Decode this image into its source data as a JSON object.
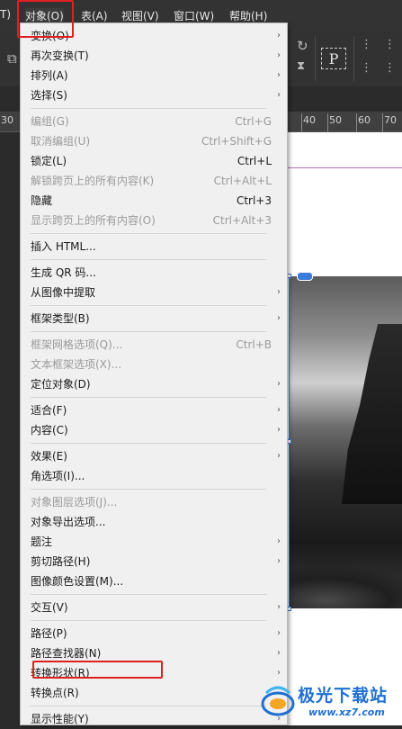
{
  "menubar": {
    "items": [
      {
        "label": "T)"
      },
      {
        "label": "对象(O)"
      },
      {
        "label": "表(A)"
      },
      {
        "label": "视图(V)"
      },
      {
        "label": "窗口(W)"
      },
      {
        "label": "帮助(H)"
      }
    ]
  },
  "toolbar": {
    "frame_icon_label": "P"
  },
  "ruler": {
    "left_label": "30",
    "labels": [
      "40",
      "50",
      "60",
      "70"
    ]
  },
  "object_menu": {
    "items": [
      {
        "label": "变换(O)",
        "shortcut": "",
        "submenu": true,
        "enabled": true
      },
      {
        "label": "再次变换(T)",
        "shortcut": "",
        "submenu": true,
        "enabled": true
      },
      {
        "label": "排列(A)",
        "shortcut": "",
        "submenu": true,
        "enabled": true
      },
      {
        "label": "选择(S)",
        "shortcut": "",
        "submenu": true,
        "enabled": true
      },
      {
        "label": "编组(G)",
        "shortcut": "Ctrl+G",
        "submenu": false,
        "enabled": false
      },
      {
        "label": "取消编组(U)",
        "shortcut": "Ctrl+Shift+G",
        "submenu": false,
        "enabled": false
      },
      {
        "label": "锁定(L)",
        "shortcut": "Ctrl+L",
        "submenu": false,
        "enabled": true
      },
      {
        "label": "解锁跨页上的所有内容(K)",
        "shortcut": "Ctrl+Alt+L",
        "submenu": false,
        "enabled": false
      },
      {
        "label": "隐藏",
        "shortcut": "Ctrl+3",
        "submenu": false,
        "enabled": true
      },
      {
        "label": "显示跨页上的所有内容(O)",
        "shortcut": "Ctrl+Alt+3",
        "submenu": false,
        "enabled": false
      },
      {
        "label": "插入 HTML...",
        "shortcut": "",
        "submenu": false,
        "enabled": true
      },
      {
        "label": "生成 QR 码...",
        "shortcut": "",
        "submenu": false,
        "enabled": true
      },
      {
        "label": "从图像中提取",
        "shortcut": "",
        "submenu": true,
        "enabled": true
      },
      {
        "label": "框架类型(B)",
        "shortcut": "",
        "submenu": true,
        "enabled": true
      },
      {
        "label": "框架网格选项(Q)...",
        "shortcut": "Ctrl+B",
        "submenu": false,
        "enabled": false
      },
      {
        "label": "文本框架选项(X)...",
        "shortcut": "",
        "submenu": false,
        "enabled": false
      },
      {
        "label": "定位对象(D)",
        "shortcut": "",
        "submenu": true,
        "enabled": true
      },
      {
        "label": "适合(F)",
        "shortcut": "",
        "submenu": true,
        "enabled": true
      },
      {
        "label": "内容(C)",
        "shortcut": "",
        "submenu": true,
        "enabled": true
      },
      {
        "label": "效果(E)",
        "shortcut": "",
        "submenu": true,
        "enabled": true
      },
      {
        "label": "角选项(I)...",
        "shortcut": "",
        "submenu": false,
        "enabled": true
      },
      {
        "label": "对象图层选项(J)...",
        "shortcut": "",
        "submenu": false,
        "enabled": false
      },
      {
        "label": "对象导出选项...",
        "shortcut": "",
        "submenu": false,
        "enabled": true
      },
      {
        "label": "题注",
        "shortcut": "",
        "submenu": true,
        "enabled": true
      },
      {
        "label": "剪切路径(H)",
        "shortcut": "",
        "submenu": true,
        "enabled": true
      },
      {
        "label": "图像颜色设置(M)...",
        "shortcut": "",
        "submenu": false,
        "enabled": true
      },
      {
        "label": "交互(V)",
        "shortcut": "",
        "submenu": true,
        "enabled": true
      },
      {
        "label": "路径(P)",
        "shortcut": "",
        "submenu": true,
        "enabled": true
      },
      {
        "label": "路径查找器(N)",
        "shortcut": "",
        "submenu": true,
        "enabled": true
      },
      {
        "label": "转换形状(R)",
        "shortcut": "",
        "submenu": true,
        "enabled": true
      },
      {
        "label": "转换点(R)",
        "shortcut": "",
        "submenu": false,
        "enabled": true
      },
      {
        "label": "显示性能(Y)",
        "shortcut": "",
        "submenu": true,
        "enabled": true
      }
    ]
  },
  "watermark": {
    "title": "极光下载站",
    "url": "www.xz7.com"
  },
  "colors": {
    "highlight": "#e02020",
    "accent": "#1f6fd1",
    "selection": "#3b7bd9"
  }
}
